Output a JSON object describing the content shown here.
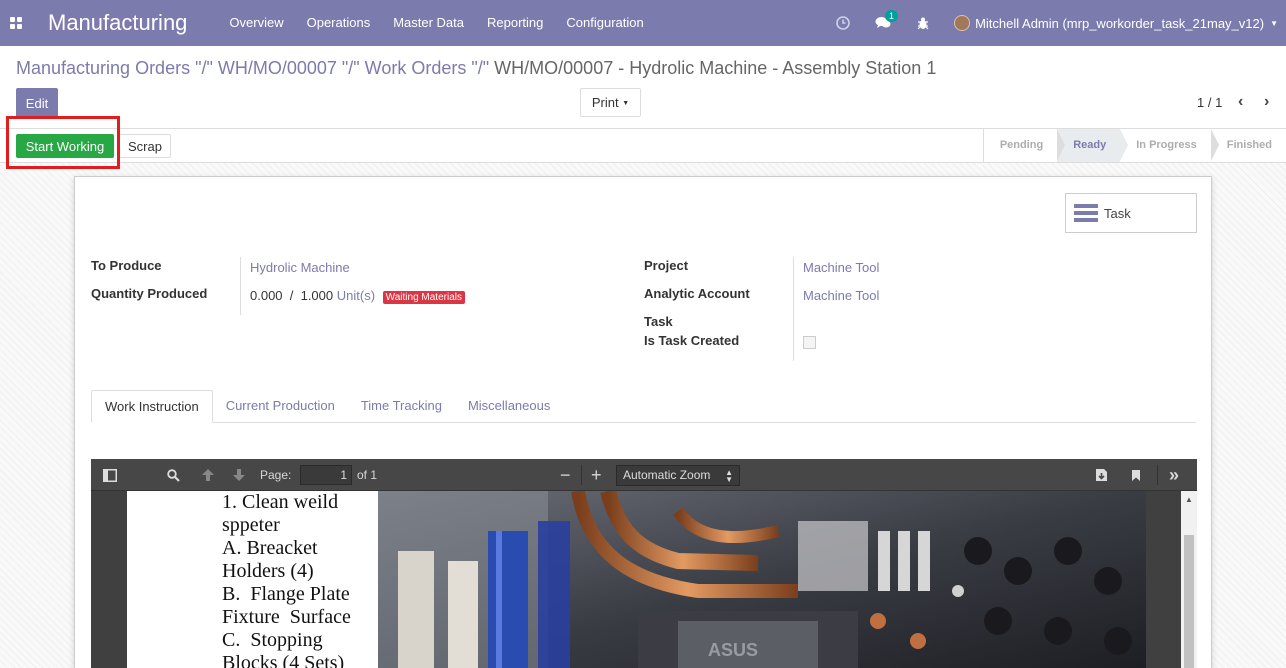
{
  "navbar": {
    "app_title": "Manufacturing",
    "menu": [
      "Overview",
      "Operations",
      "Master Data",
      "Reporting",
      "Configuration"
    ],
    "message_count": "1",
    "user": "Mitchell Admin (mrp_workorder_task_21may_v12)"
  },
  "breadcrumb": {
    "part1": "Manufacturing Orders \"/\" WH/MO/00007 \"/\" Work Orders \"/\"",
    "current": "WH/MO/00007 - Hydrolic Machine - Assembly Station 1"
  },
  "buttons": {
    "edit": "Edit",
    "print": "Print",
    "start_working": "Start Working",
    "scrap": "Scrap"
  },
  "pager": "1 / 1",
  "stages": [
    {
      "label": "Pending",
      "active": false
    },
    {
      "label": "Ready",
      "active": true
    },
    {
      "label": "In Progress",
      "active": false
    },
    {
      "label": "Finished",
      "active": false
    }
  ],
  "form": {
    "task_button": "Task",
    "to_produce_label": "To Produce",
    "to_produce_value": "Hydrolic Machine",
    "qty_label": "Quantity Produced",
    "qty_value": "0.000  /  1.000",
    "qty_uom": "Unit(s)",
    "qty_status": "Waiting Materials",
    "project_label": "Project",
    "project_value": "Machine Tool",
    "analytic_label": "Analytic Account",
    "analytic_value": "Machine Tool",
    "task_label": "Task",
    "is_task_label": "Is Task Created"
  },
  "tabs": [
    "Work Instruction",
    "Current Production",
    "Time Tracking",
    "Miscellaneous"
  ],
  "pdf": {
    "page_label": "Page:",
    "page_value": "1",
    "page_total": "of 1",
    "zoom": "Automatic Zoom",
    "lines": [
      "1. Clean weild",
      "sppeter",
      "A. Breacket",
      "Holders (4)",
      "B.  Flange Plate",
      "Fixture  Surface",
      "C.  Stopping",
      "Blocks (4 Sets)"
    ]
  },
  "colors": {
    "brand": "#7c7bad",
    "start_button": "#28a745",
    "waiting_badge": "#dc3545",
    "highlight": "#e21d1d"
  }
}
